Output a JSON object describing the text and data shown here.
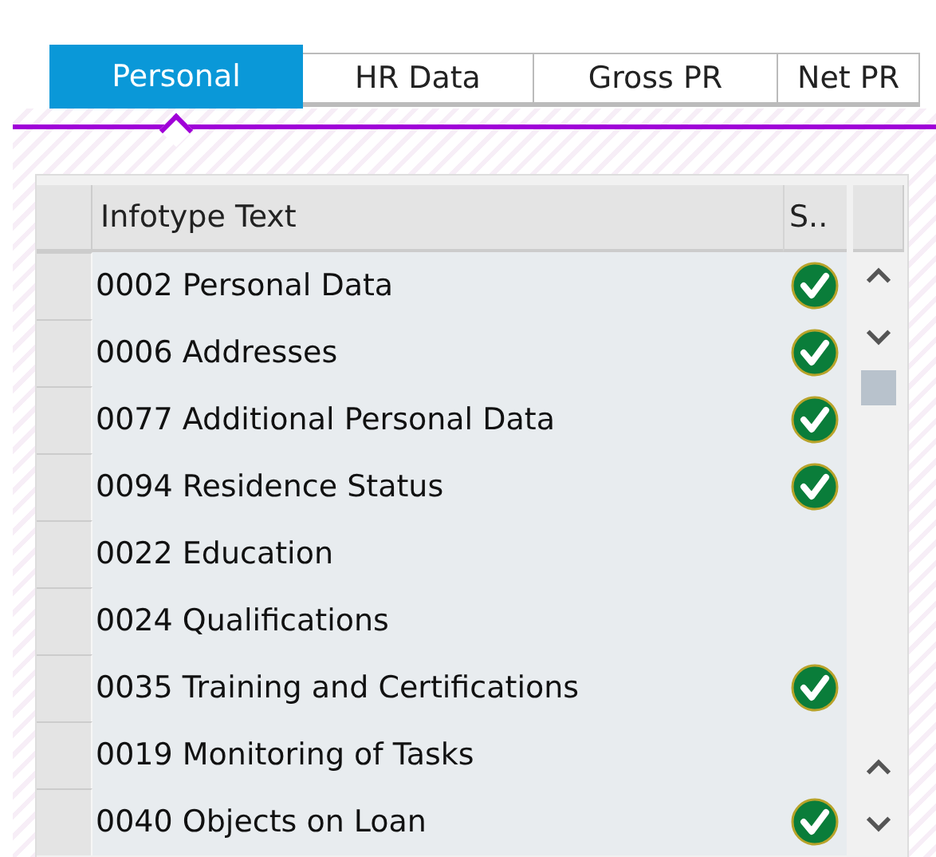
{
  "tabs": [
    {
      "label": "Personal",
      "selected": true
    },
    {
      "label": "HR Data",
      "selected": false
    },
    {
      "label": "Gross PR",
      "selected": false
    },
    {
      "label": "Net PR",
      "selected": false
    }
  ],
  "table": {
    "columns": [
      "Infotype Text",
      "S.."
    ],
    "rows": [
      {
        "text": "0002 Personal Data",
        "status": true
      },
      {
        "text": "0006 Addresses",
        "status": true
      },
      {
        "text": "0077 Additional Personal Data",
        "status": true
      },
      {
        "text": "0094 Residence Status",
        "status": true
      },
      {
        "text": "0022 Education",
        "status": false
      },
      {
        "text": "0024 Qualifications",
        "status": false
      },
      {
        "text": "0035 Training and Certifications",
        "status": true
      },
      {
        "text": "0019 Monitoring of Tasks",
        "status": false
      },
      {
        "text": "0040 Objects on Loan",
        "status": true
      }
    ]
  }
}
